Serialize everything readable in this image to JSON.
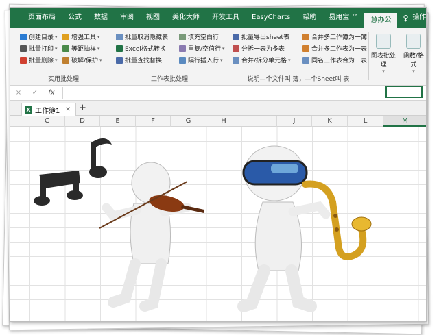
{
  "ribbon_tabs": [
    "页面布局",
    "公式",
    "数据",
    "审阅",
    "视图",
    "美化大师",
    "开发工具",
    "EasyCharts",
    "帮助",
    "易用宝 ™",
    "慧办公",
    "操作说明"
  ],
  "active_tab_index": 10,
  "groups": {
    "g1": {
      "label": "实用批处理",
      "items": [
        "创建目录",
        "批量打印",
        "批量删除",
        "增强工具",
        "等距抽样",
        "破解/保护"
      ]
    },
    "g2": {
      "label": "工作表批处理",
      "items": [
        "批量取消隐藏表",
        "Excel格式转换",
        "批量查找替换",
        "填充空白行",
        "重复/空值行",
        "隔行插入行"
      ]
    },
    "g3": {
      "label": "说明—个文件叫 簿，—个Sheet叫 表",
      "items": [
        "批量导出sheet表",
        "分拆一表为多表",
        "合并/拆分单元格",
        "合并多工作簿为一簿",
        "合并多工作表为一表",
        "同名工作表合为一表"
      ]
    },
    "g4": {
      "big1": "图表批处理",
      "big2": "函数/格式"
    }
  },
  "formula_bar": {
    "cancel": "×",
    "confirm": "✓",
    "fx": "fx",
    "value": ""
  },
  "workbook_tab": {
    "name": "工作簿1",
    "add": "+"
  },
  "columns": [
    "C",
    "D",
    "E",
    "F",
    "G",
    "H",
    "I",
    "J",
    "K",
    "L",
    "M"
  ],
  "selected_column": "M",
  "colors": {
    "excel_green": "#217346",
    "ribbon_bg": "#f3f3f3"
  }
}
